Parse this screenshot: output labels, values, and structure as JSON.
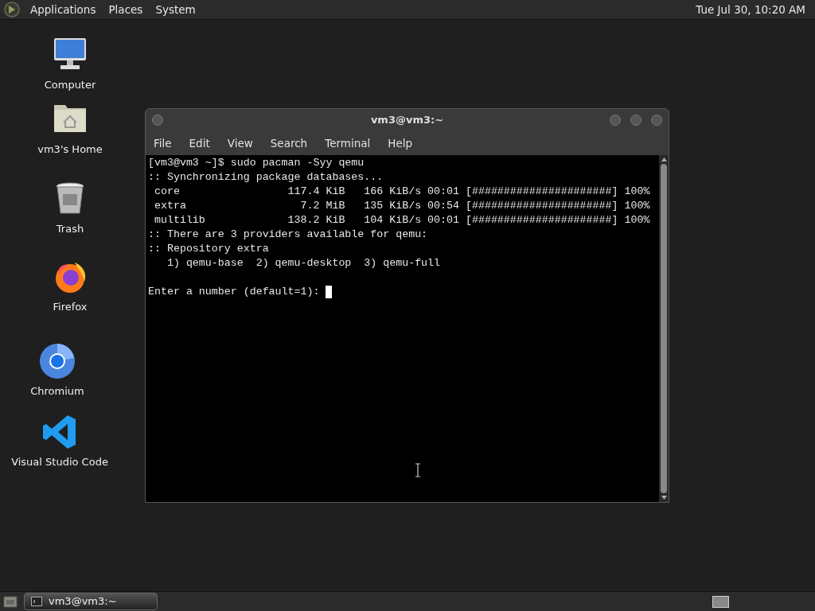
{
  "top_panel": {
    "menus": [
      "Applications",
      "Places",
      "System"
    ],
    "clock": "Tue Jul 30, 10:20 AM"
  },
  "desktop_icons": [
    {
      "kind": "computer",
      "label": "Computer"
    },
    {
      "kind": "home",
      "label": "vm3's Home"
    },
    {
      "kind": "trash",
      "label": "Trash"
    },
    {
      "kind": "firefox",
      "label": "Firefox"
    },
    {
      "kind": "chromium",
      "label": "Chromium"
    },
    {
      "kind": "vscode",
      "label": "Visual Studio Code"
    }
  ],
  "terminal_window": {
    "title": "vm3@vm3:~",
    "menu": [
      "File",
      "Edit",
      "View",
      "Search",
      "Terminal",
      "Help"
    ],
    "lines": [
      "[vm3@vm3 ~]$ sudo pacman -Syy qemu",
      ":: Synchronizing package databases...",
      " core                 117.4 KiB   166 KiB/s 00:01 [######################] 100%",
      " extra                  7.2 MiB   135 KiB/s 00:54 [######################] 100%",
      " multilib             138.2 KiB   104 KiB/s 00:01 [######################] 100%",
      ":: There are 3 providers available for qemu:",
      ":: Repository extra",
      "   1) qemu-base  2) qemu-desktop  3) qemu-full"
    ],
    "prompt": "Enter a number (default=1): "
  },
  "taskbar": {
    "tasks": [
      {
        "label": "vm3@vm3:~",
        "selected": true
      }
    ]
  }
}
